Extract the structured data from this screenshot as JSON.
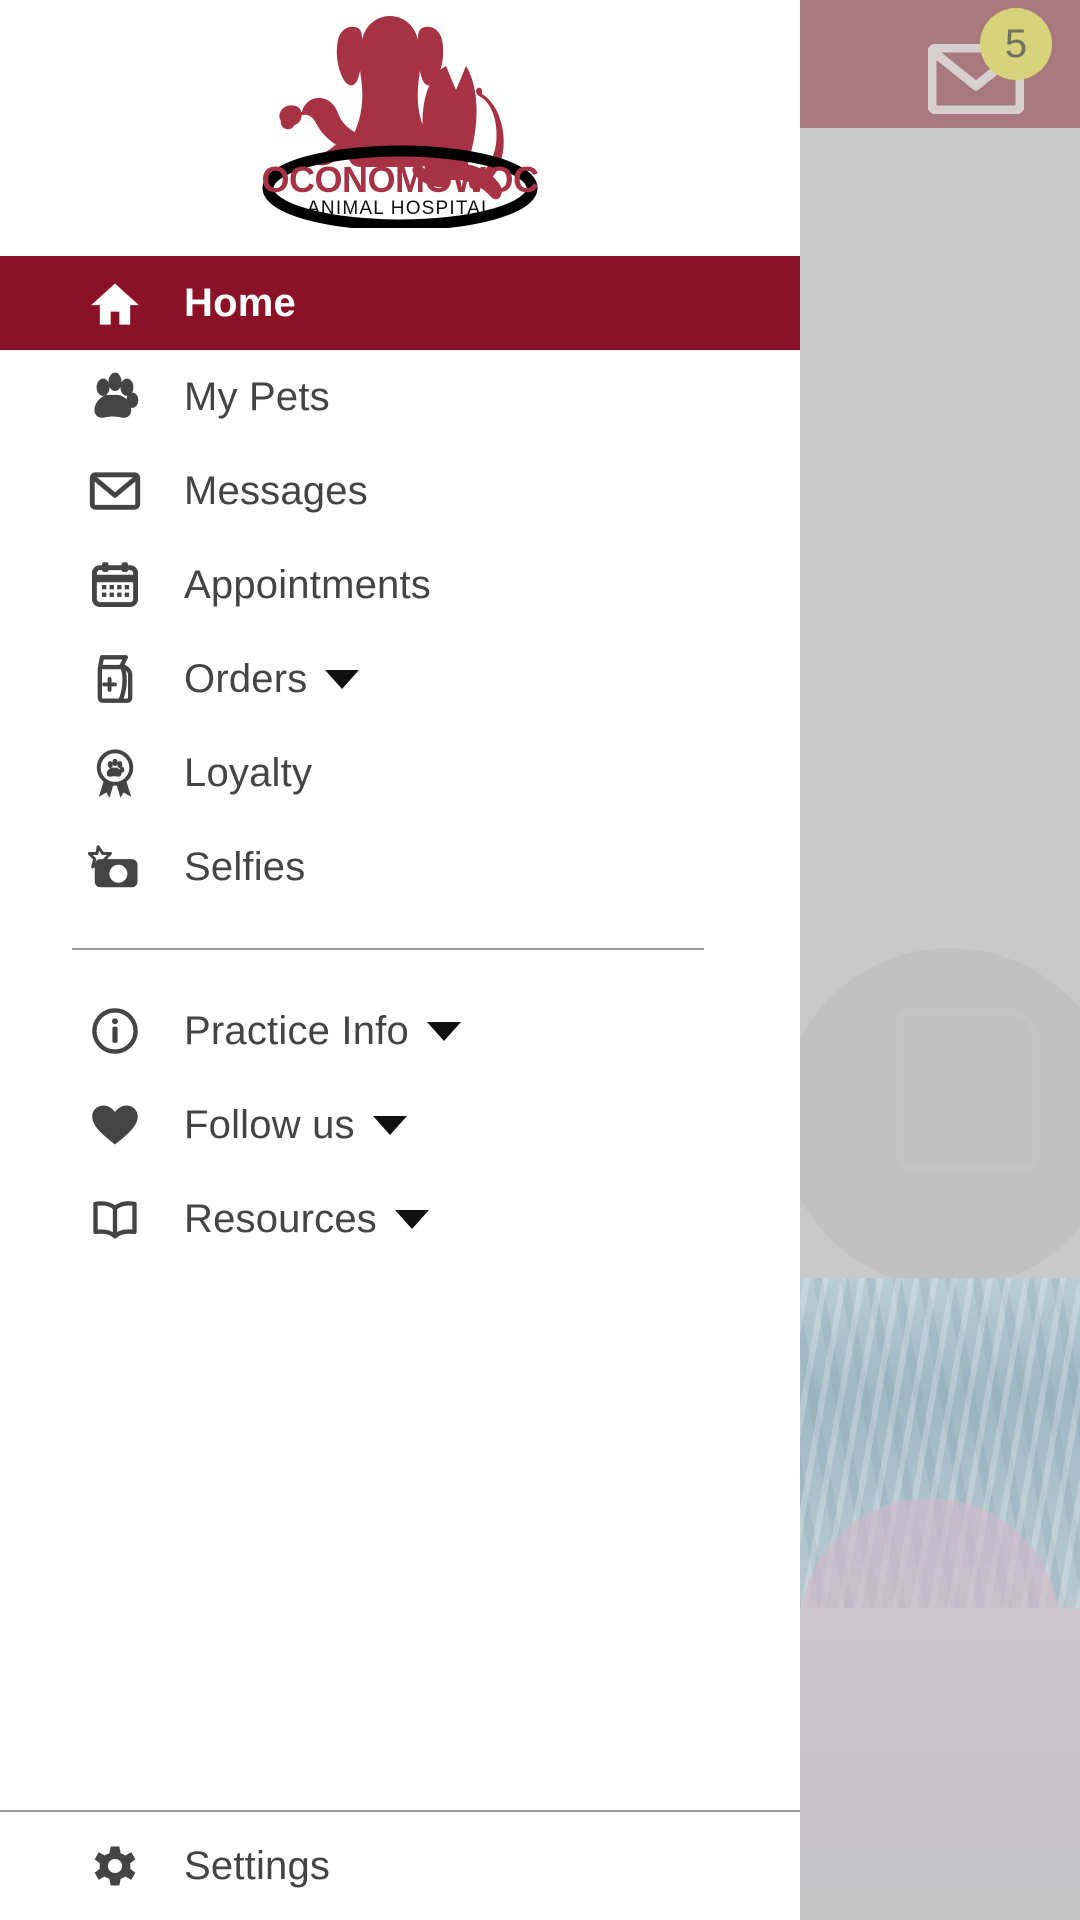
{
  "app": {
    "drawer_title": "Oconomowoc Animal Hospital"
  },
  "logo": {
    "name": "oconomowoc-animal-hospital-logo",
    "primary_text": "OCONOMOWOC",
    "secondary_text": "ANIMAL HOSPITAL",
    "brand_color": "#A63244",
    "outline_color": "#000000"
  },
  "close_button": {
    "label": "×",
    "icon": "close-icon"
  },
  "background": {
    "header_color": "#A8797F",
    "badge_count": "5",
    "badge_color": "#D8D27A",
    "envelope_icon": "envelope-icon"
  },
  "menu": {
    "active_color": "#8B1226",
    "icon_color": "#444444",
    "primary_items": [
      {
        "label": "Home",
        "icon": "home-icon",
        "active": true,
        "has_caret": false
      },
      {
        "label": "My Pets",
        "icon": "paw-icon",
        "active": false,
        "has_caret": false
      },
      {
        "label": "Messages",
        "icon": "envelope-icon",
        "active": false,
        "has_caret": false
      },
      {
        "label": "Appointments",
        "icon": "calendar-icon",
        "active": false,
        "has_caret": false
      },
      {
        "label": "Orders",
        "icon": "food-bag-icon",
        "active": false,
        "has_caret": true
      },
      {
        "label": "Loyalty",
        "icon": "award-paw-icon",
        "active": false,
        "has_caret": false
      },
      {
        "label": "Selfies",
        "icon": "camera-star-icon",
        "active": false,
        "has_caret": false
      }
    ],
    "secondary_items": [
      {
        "label": "Practice Info",
        "icon": "info-circle-icon",
        "active": false,
        "has_caret": true
      },
      {
        "label": "Follow us",
        "icon": "heart-icon",
        "active": false,
        "has_caret": true
      },
      {
        "label": "Resources",
        "icon": "book-icon",
        "active": false,
        "has_caret": true
      }
    ],
    "bottom_items": [
      {
        "label": "Settings",
        "icon": "gear-icon",
        "active": false,
        "has_caret": false
      }
    ]
  }
}
